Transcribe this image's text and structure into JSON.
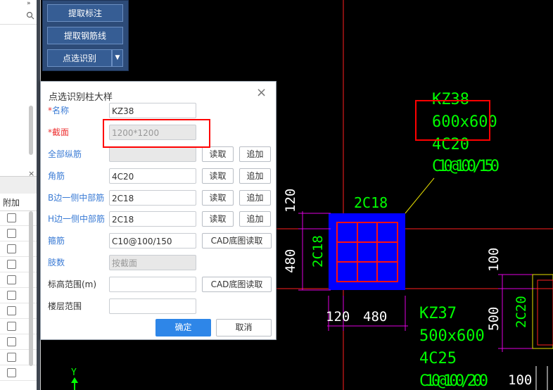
{
  "toolbar": {
    "extract_annotation": "提取标注",
    "extract_rebar_line": "提取钢筋线",
    "click_identify": "点选识别"
  },
  "left_panel": {
    "header_label": "附加",
    "row_count": 11
  },
  "dialog": {
    "title": "点选识别柱大样",
    "read_label": "读取",
    "add_label": "追加",
    "cad_read_label": "CAD底图读取",
    "ok_label": "确定",
    "cancel_label": "取消",
    "fields": {
      "name": {
        "label": "名称",
        "value": "KZ38"
      },
      "section": {
        "label": "截面",
        "placeholder": "1200*1200"
      },
      "all_long_rebar": {
        "label": "全部纵筋",
        "value": ""
      },
      "corner_rebar": {
        "label": "角筋",
        "value": "4C20"
      },
      "b_side_rebar": {
        "label": "B边一侧中部筋",
        "value": "2C18"
      },
      "h_side_rebar": {
        "label": "H边一侧中部筋",
        "value": "2C18"
      },
      "stirrup": {
        "label": "箍筋",
        "value": "C10@100/150"
      },
      "legs": {
        "label": "肢数",
        "placeholder": "按截面"
      },
      "elevation_range": {
        "label": "标高范围(m)",
        "value": ""
      },
      "floor_range": {
        "label": "楼层范围",
        "value": ""
      }
    }
  },
  "cad": {
    "kz38": {
      "name": "KZ38",
      "size": "600x600",
      "corner": "4C20",
      "stirrup": "C10@100/150"
    },
    "kz37": {
      "name": "KZ37",
      "size": "500x600",
      "corner": "4C25",
      "stirrup": "C10@100/200"
    },
    "top_bar_label": "2C18",
    "side_bar_label": "2C18",
    "dims": {
      "top_120": "120",
      "left_480": "480",
      "bottom_120": "120",
      "bottom_480": "480",
      "right_100": "100",
      "right_500": "500",
      "right_2c20": "2C20",
      "bottom_right_100": "100"
    },
    "y_axis": "Y"
  },
  "colors": {
    "cad_text": "#00ff00",
    "column_fill": "#0000ff",
    "rebar": "#ff0000",
    "dimension": "#ff00ff",
    "highlight": "#ff0000",
    "toolbar_bg": "#2d4b78",
    "primary_button": "#2e86e8"
  }
}
